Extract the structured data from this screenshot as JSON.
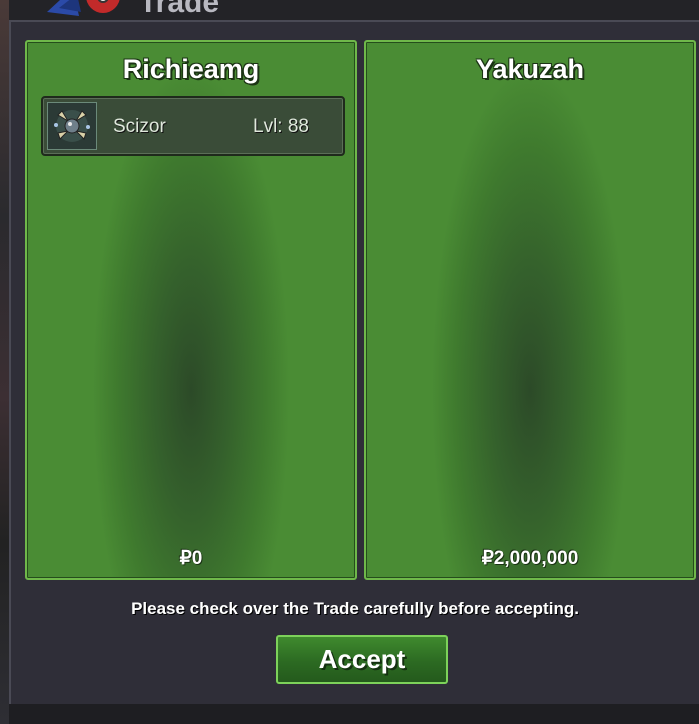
{
  "window": {
    "title": "Trade"
  },
  "trade": {
    "left_player": {
      "name": "Richieamg",
      "items": [
        {
          "pokemon": "Scizor",
          "level": "Lvl: 88",
          "icon": "scizor-icon"
        }
      ],
      "money": "₽0"
    },
    "right_player": {
      "name": "Yakuzah",
      "items": [],
      "money": "₽2,000,000"
    }
  },
  "footer": {
    "message": "Please check over the Trade carefully before accepting.",
    "accept_label": "Accept"
  },
  "colors": {
    "panel_border": "#6fb84a",
    "panel_green": "#3f7a2e",
    "window_bg": "#2f2e38",
    "accept_border": "#7dd25a"
  }
}
